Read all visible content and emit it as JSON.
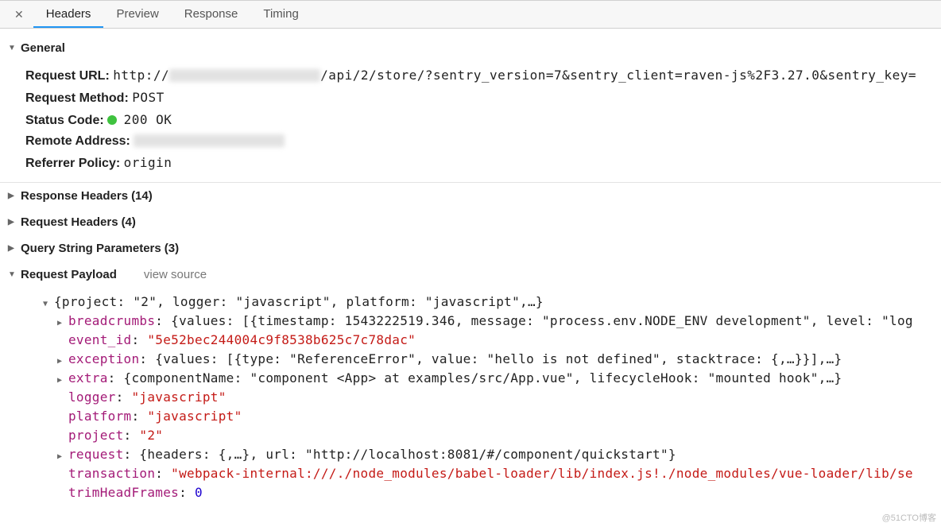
{
  "tabs": {
    "headers": "Headers",
    "preview": "Preview",
    "response": "Response",
    "timing": "Timing"
  },
  "sections": {
    "general": "General",
    "responseHeaders": "Response Headers",
    "responseHeadersCount": "(14)",
    "requestHeaders": "Request Headers",
    "requestHeadersCount": "(4)",
    "queryString": "Query String Parameters",
    "queryStringCount": "(3)",
    "requestPayload": "Request Payload",
    "viewSource": "view source"
  },
  "general": {
    "requestUrlLabel": "Request URL:",
    "urlPrefix": "http://",
    "urlSuffix": "/api/2/store/?sentry_version=7&sentry_client=raven-js%2F3.27.0&sentry_key=",
    "requestMethodLabel": "Request Method:",
    "requestMethod": "POST",
    "statusCodeLabel": "Status Code:",
    "statusCode": "200 OK",
    "remoteAddressLabel": "Remote Address:",
    "referrerPolicyLabel": "Referrer Policy:",
    "referrerPolicy": "origin"
  },
  "payload": {
    "root": "{project: \"2\", logger: \"javascript\", platform: \"javascript\",…}",
    "breadcrumbs_key": "breadcrumbs",
    "breadcrumbs_val": "{values: [{timestamp: 1543222519.346, message: \"process.env.NODE_ENV development\", level: \"log",
    "event_id_key": "event_id",
    "event_id_val": "\"5e52bec244004c9f8538b625c7c78dac\"",
    "exception_key": "exception",
    "exception_val": "{values: [{type: \"ReferenceError\", value: \"hello is not defined\", stacktrace: {,…}}],…}",
    "extra_key": "extra",
    "extra_val": "{componentName: \"component <App> at examples/src/App.vue\", lifecycleHook: \"mounted hook\",…}",
    "logger_key": "logger",
    "logger_val": "\"javascript\"",
    "platform_key": "platform",
    "platform_val": "\"javascript\"",
    "project_key": "project",
    "project_val": "\"2\"",
    "request_key": "request",
    "request_val": "{headers: {,…}, url: \"http://localhost:8081/#/component/quickstart\"}",
    "transaction_key": "transaction",
    "transaction_val": "\"webpack-internal:///./node_modules/babel-loader/lib/index.js!./node_modules/vue-loader/lib/se",
    "trim_key": "trimHeadFrames",
    "trim_val": "0"
  },
  "watermark": "@51CTO博客"
}
